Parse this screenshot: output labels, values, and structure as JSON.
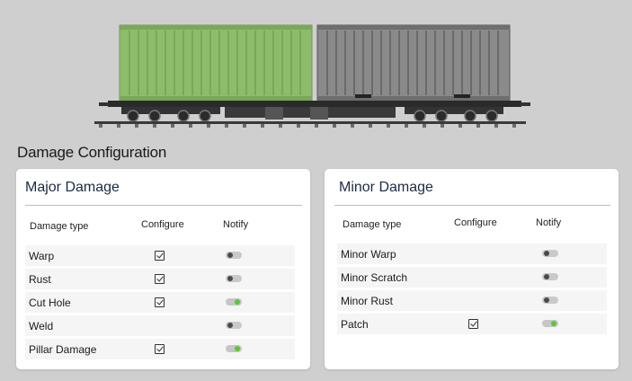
{
  "page": {
    "title": "Damage Configuration"
  },
  "colors": {
    "container_left": "#8dbd6a",
    "container_right": "#8a8a8a",
    "toggle_on": "#59c832",
    "toggle_off": "#4a4a4a"
  },
  "major": {
    "title": "Major Damage",
    "headers": {
      "type": "Damage type",
      "configure": "Configure",
      "notify": "Notify"
    },
    "rows": [
      {
        "label": "Warp",
        "configure": true,
        "notify": false
      },
      {
        "label": "Rust",
        "configure": true,
        "notify": false
      },
      {
        "label": "Cut Hole",
        "configure": true,
        "notify": true
      },
      {
        "label": "Weld",
        "configure": false,
        "notify": false
      },
      {
        "label": "Pillar Damage",
        "configure": true,
        "notify": true
      }
    ]
  },
  "minor": {
    "title": "Minor Damage",
    "headers": {
      "type": "Damage type",
      "configure": "Configure",
      "notify": "Notify"
    },
    "rows": [
      {
        "label": "Minor Warp",
        "configure": false,
        "notify": false
      },
      {
        "label": "Minor Scratch",
        "configure": false,
        "notify": false
      },
      {
        "label": "Minor Rust",
        "configure": false,
        "notify": false
      },
      {
        "label": "Patch",
        "configure": true,
        "notify": true
      }
    ]
  }
}
